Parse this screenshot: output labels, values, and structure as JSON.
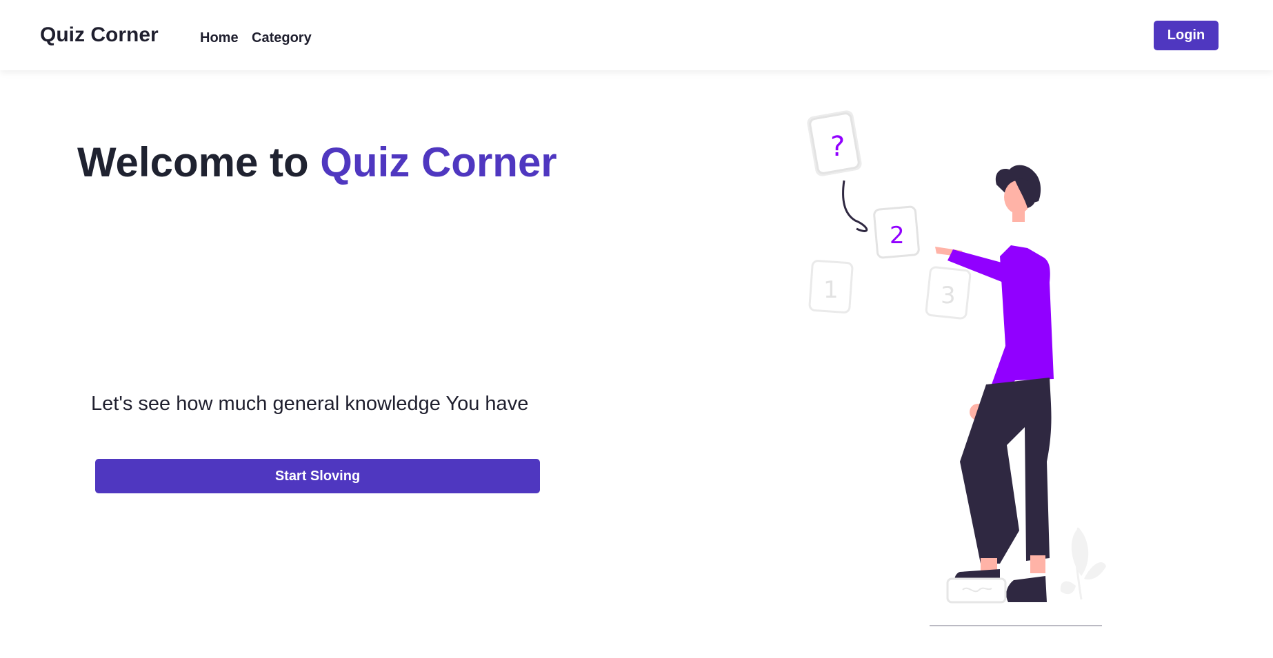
{
  "navbar": {
    "brand": "Quiz Corner",
    "links": [
      {
        "label": "Home"
      },
      {
        "label": "Category"
      }
    ],
    "login_label": "Login"
  },
  "hero": {
    "title_prefix": "Welcome to",
    "title_accent": "Quiz Corner",
    "tagline": "Let's see how much general knowledge You have",
    "start_label": "Start Sloving"
  },
  "illustration": {
    "cards": [
      "?",
      "2",
      "1",
      "3"
    ],
    "colors": {
      "accent": "#4f37c0",
      "shirt": "#9100ff",
      "pants": "#2f2841",
      "skin": "#ffb3a7",
      "card_outline": "#e6e6e6"
    },
    "icons": [
      "question-card-icon",
      "person-figure-icon",
      "plant-icon"
    ]
  }
}
